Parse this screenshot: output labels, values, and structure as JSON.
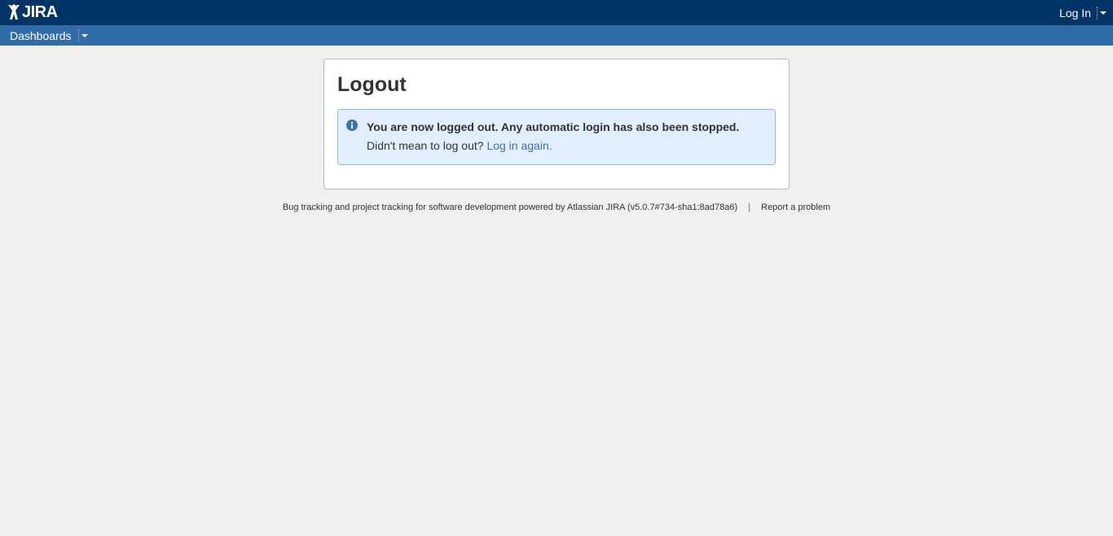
{
  "header": {
    "logo_text": "JIRA",
    "logo_icon": "jira-logo-icon",
    "login_label": "Log In",
    "colors": {
      "header_bg": "#003366",
      "navbar_bg": "#2f6ca8"
    }
  },
  "nav": {
    "dashboards_label": "Dashboards"
  },
  "panel": {
    "title": "Logout",
    "message": {
      "icon": "info-icon",
      "title": "You are now logged out. Any automatic login has also been stopped.",
      "body_prefix": "Didn't mean to log out?",
      "link_label": "Log in again.",
      "colors": {
        "bg": "#e0eefd",
        "border": "#99b6d9",
        "icon": "#3b73af"
      }
    }
  },
  "footer": {
    "text": "Bug tracking and project tracking for software development powered by Atlassian JIRA (v5.0.7#734-sha1:8ad78a6)",
    "separator": "|",
    "report_label": "Report a problem"
  }
}
